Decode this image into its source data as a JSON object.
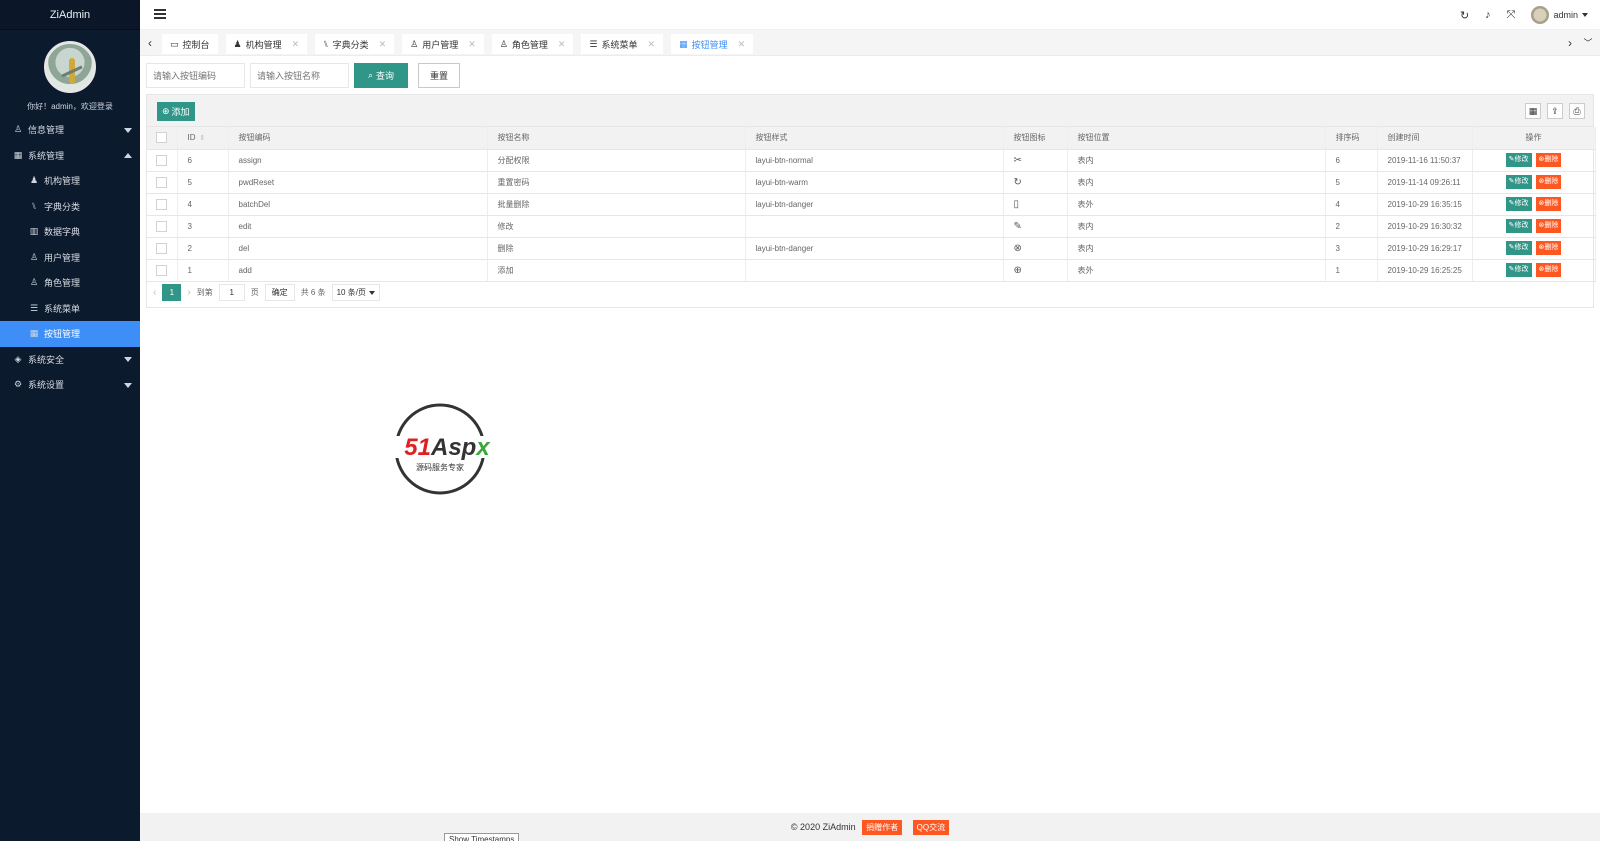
{
  "app": {
    "title": "ZiAdmin"
  },
  "sidebar": {
    "welcome": "你好！admin，欢迎登录",
    "items": [
      {
        "label": "信息管理",
        "icon": "user-icon",
        "glyph": "♙"
      },
      {
        "label": "系统管理",
        "icon": "grid-icon",
        "glyph": "▦"
      },
      {
        "label": "机构管理",
        "icon": "org-icon",
        "glyph": "♟"
      },
      {
        "label": "字典分类",
        "icon": "tree-icon",
        "glyph": "⑊"
      },
      {
        "label": "数据字典",
        "icon": "bar-chart-icon",
        "glyph": "▥"
      },
      {
        "label": "用户管理",
        "icon": "person-icon",
        "glyph": "♙"
      },
      {
        "label": "角色管理",
        "icon": "role-icon",
        "glyph": "♙"
      },
      {
        "label": "系统菜单",
        "icon": "list-icon",
        "glyph": "☰"
      },
      {
        "label": "按钮管理",
        "icon": "grid-icon",
        "glyph": "▦"
      },
      {
        "label": "系统安全",
        "icon": "shield-icon",
        "glyph": "◈"
      },
      {
        "label": "系统设置",
        "icon": "gear-icon",
        "glyph": "⚙"
      }
    ]
  },
  "header": {
    "user": "admin",
    "refresh_glyph": "↻",
    "bell_glyph": "♪",
    "fullscreen_glyph": "⤧"
  },
  "tabs": [
    {
      "label": "控制台",
      "glyph": "▭",
      "closable": false
    },
    {
      "label": "机构管理",
      "glyph": "♟",
      "closable": true
    },
    {
      "label": "字典分类",
      "glyph": "⑊",
      "closable": true
    },
    {
      "label": "用户管理",
      "glyph": "♙",
      "closable": true
    },
    {
      "label": "角色管理",
      "glyph": "♙",
      "closable": true
    },
    {
      "label": "系统菜单",
      "glyph": "☰",
      "closable": true
    },
    {
      "label": "按钮管理",
      "glyph": "▦",
      "closable": true,
      "active": true
    }
  ],
  "search": {
    "code_placeholder": "请输入按钮编码",
    "name_placeholder": "请输入按钮名称",
    "query_label": "查询",
    "reset_label": "重置"
  },
  "toolbar": {
    "add_label": "添加"
  },
  "table": {
    "columns": [
      "ID",
      "按钮编码",
      "按钮名称",
      "按钮样式",
      "按钮图标",
      "按钮位置",
      "排序码",
      "创建时间",
      "操作"
    ],
    "edit_label": "修改",
    "delete_label": "删除",
    "rows": [
      {
        "id": "6",
        "code": "assign",
        "name": "分配权限",
        "style": "layui-btn-normal",
        "icon": "✂",
        "position": "表内",
        "sort": "6",
        "created": "2019-11-16 11:50:37"
      },
      {
        "id": "5",
        "code": "pwdReset",
        "name": "重置密码",
        "style": "layui-btn-warm",
        "icon": "↻",
        "position": "表内",
        "sort": "5",
        "created": "2019-11-14 09:26:11"
      },
      {
        "id": "4",
        "code": "batchDel",
        "name": "批量删除",
        "style": "layui-btn-danger",
        "icon": "▯",
        "position": "表外",
        "sort": "4",
        "created": "2019-10-29 16:35:15"
      },
      {
        "id": "3",
        "code": "edit",
        "name": "修改",
        "style": "",
        "icon": "✎",
        "position": "表内",
        "sort": "2",
        "created": "2019-10-29 16:30:32"
      },
      {
        "id": "2",
        "code": "del",
        "name": "删除",
        "style": "layui-btn-danger",
        "icon": "⊗",
        "position": "表内",
        "sort": "3",
        "created": "2019-10-29 16:29:17"
      },
      {
        "id": "1",
        "code": "add",
        "name": "添加",
        "style": "",
        "icon": "⊕",
        "position": "表外",
        "sort": "1",
        "created": "2019-10-29 16:25:25"
      }
    ]
  },
  "pager": {
    "current": "1",
    "goto_label": "到第",
    "page_input": "1",
    "page_unit": "页",
    "confirm_label": "确定",
    "total": "共 6 条",
    "page_size": "10 条/页"
  },
  "watermark": {
    "brand": "51Aspx",
    "tagline": "源码服务专家"
  },
  "footer": {
    "copyright": "© 2020 ZiAdmin",
    "badge1": "捐赠作者",
    "badge2": "QQ交流",
    "timestamps_button": "Show Timestamps"
  },
  "colors": {
    "sidebar_bg": "#0c1a2e",
    "active_blue": "#3e8ef7",
    "primary_green": "#2f9688",
    "danger_orange": "#ff5722"
  }
}
